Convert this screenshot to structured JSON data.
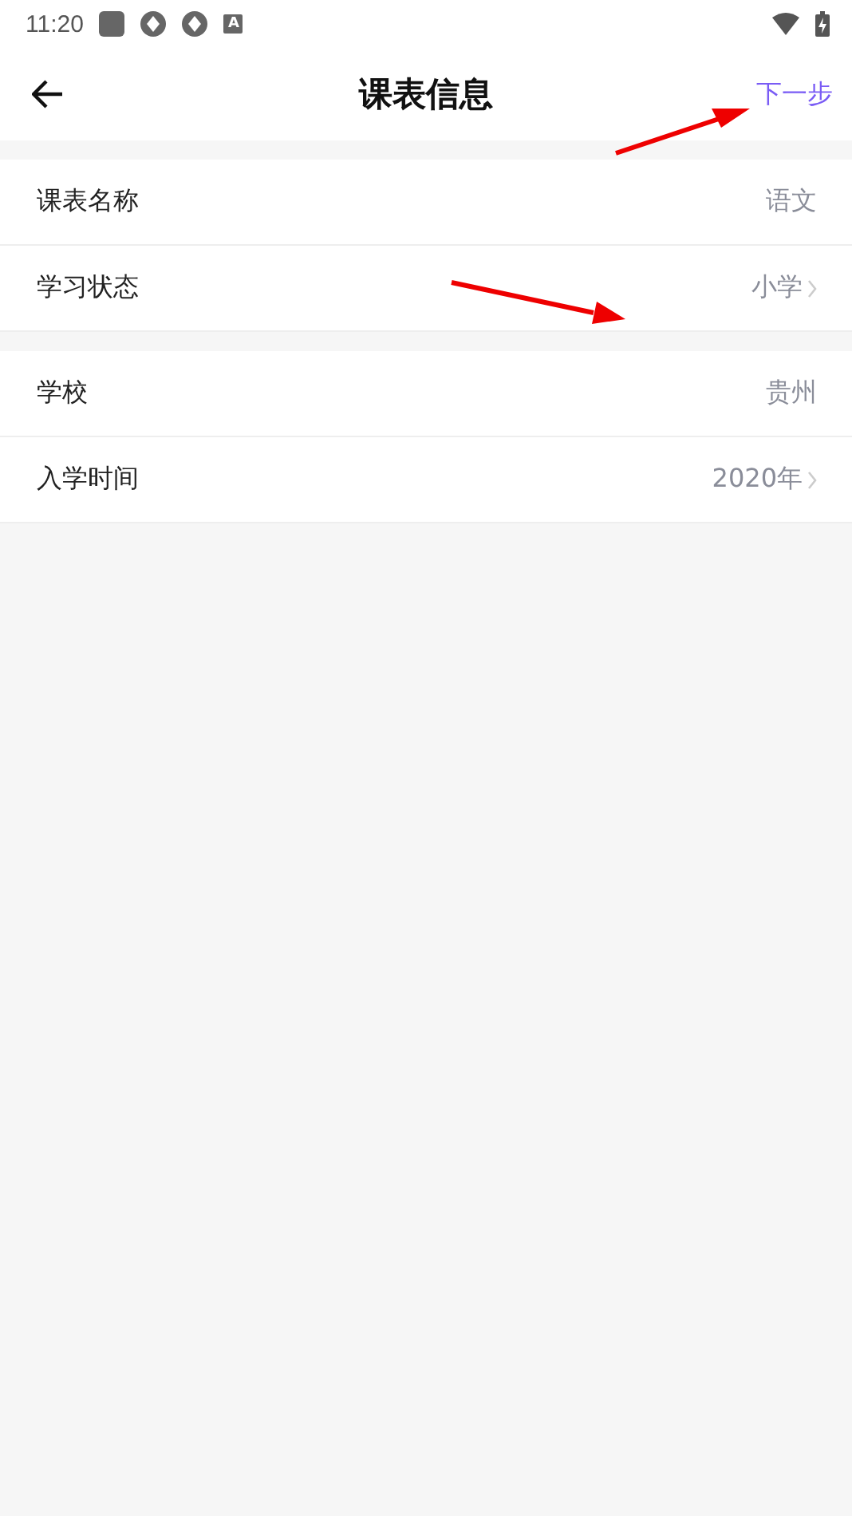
{
  "status_bar": {
    "time": "11:20",
    "badge_letter": "A"
  },
  "header": {
    "title": "课表信息",
    "action": "下一步"
  },
  "sections": [
    {
      "rows": [
        {
          "label": "课表名称",
          "value": "语文",
          "chevron": false
        },
        {
          "label": "学习状态",
          "value": "小学",
          "chevron": true
        }
      ]
    },
    {
      "rows": [
        {
          "label": "学校",
          "value": "贵州",
          "chevron": false
        },
        {
          "label": "入学时间",
          "value": "2020年",
          "chevron": true
        }
      ]
    }
  ]
}
